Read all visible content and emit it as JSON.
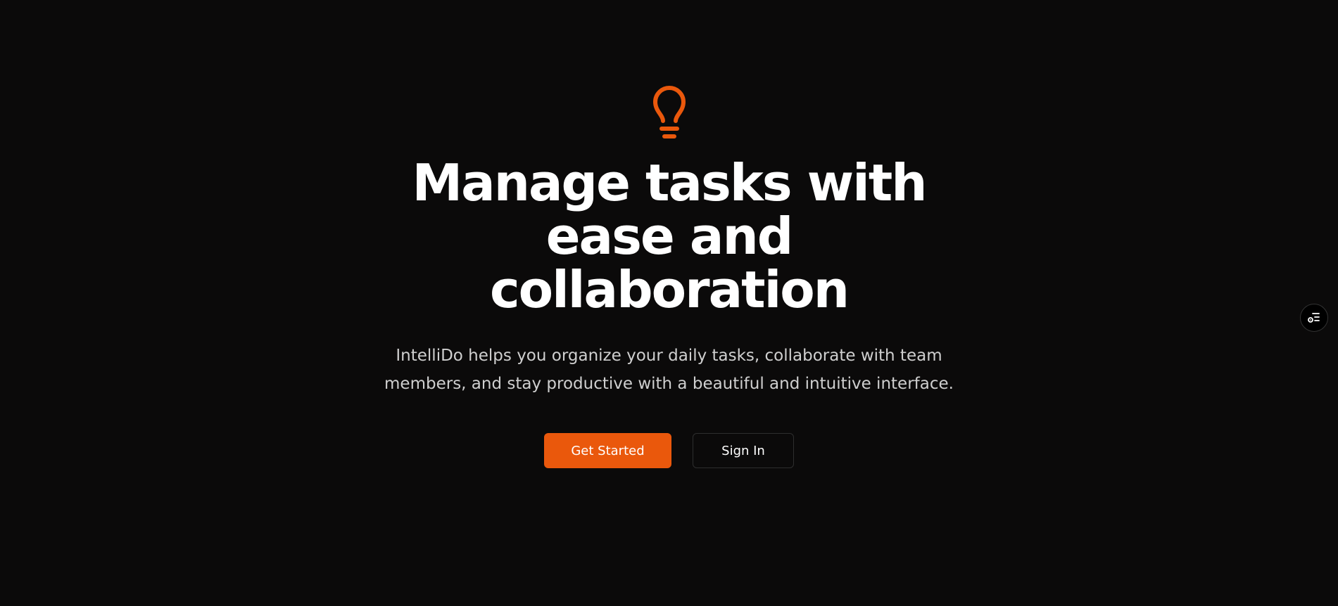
{
  "brand": {
    "accent_color": "#ea580c",
    "background_color": "#0b0a0a",
    "logo_icon": "lightbulb-icon"
  },
  "hero": {
    "headline": "Manage tasks with ease and collaboration",
    "subtitle": "IntelliDo helps you organize your daily tasks, collaborate with team members, and stay productive with a beautiful and intuitive interface."
  },
  "actions": {
    "get_started_label": "Get Started",
    "sign_in_label": "Sign In"
  },
  "floating_widget": {
    "icon": "list-settings-icon"
  }
}
